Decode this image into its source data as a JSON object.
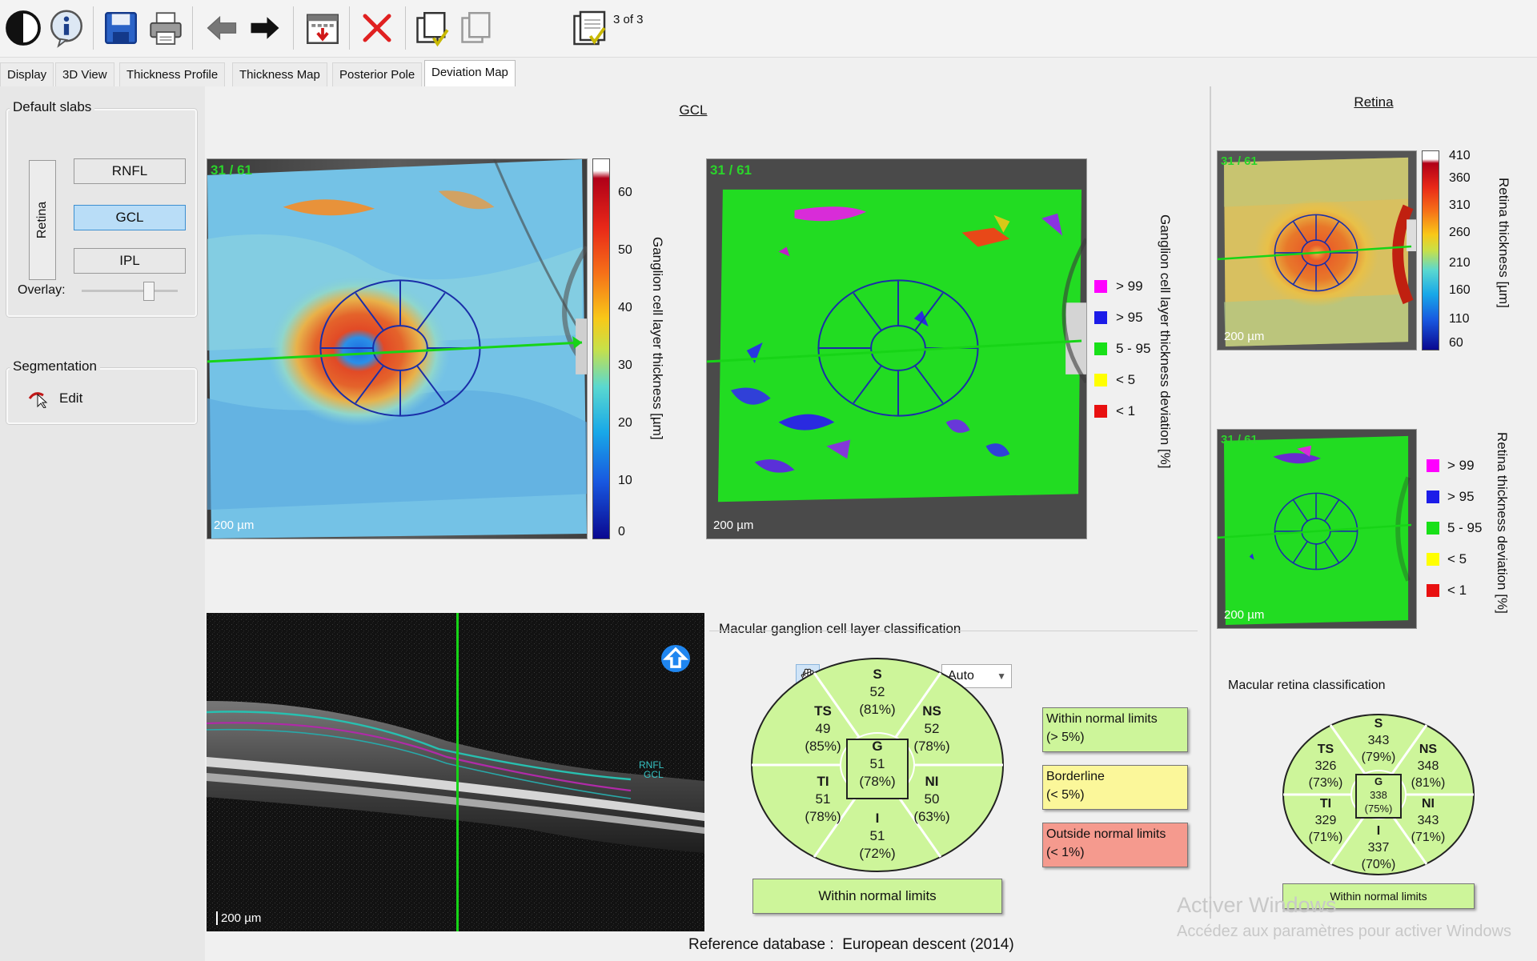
{
  "toolbar": {
    "page_count": "3 of 3",
    "buttons": [
      "contrast-icon",
      "info-icon",
      "save-icon",
      "print-icon",
      "back-arrow-icon",
      "forward-arrow-icon",
      "calendar-export-icon",
      "delete-icon",
      "copy-icon",
      "copy-disabled-icon",
      "page-report-icon"
    ]
  },
  "tabs": [
    "Display",
    "3D View",
    "Thickness Profile",
    "Thickness Map",
    "Posterior Pole",
    "Deviation Map"
  ],
  "active_tab": "Deviation Map",
  "left_panel": {
    "default_slabs_title": "Default slabs",
    "retina_tab": "Retina",
    "slabs": [
      "RNFL",
      "GCL",
      "IPL"
    ],
    "selected_slab": "GCL",
    "overlay_label": "Overlay:",
    "overlay_level": 0.7,
    "segmentation_title": "Segmentation",
    "edit_label": "Edit"
  },
  "gcl_section": {
    "title": "GCL",
    "map_index": "31 / 61",
    "scale_label": "200 µm",
    "thickness_axis_label": "Ganglion cell layer thickness [µm]",
    "thickness_ticks": [
      "60",
      "50",
      "40",
      "30",
      "20",
      "10",
      "0"
    ],
    "deviation_axis_label": "Ganglion cell layer thickness deviation [%]",
    "deviation_legend": [
      {
        "label": "> 99",
        "color": "#ff00ff"
      },
      {
        "label": "> 95",
        "color": "#1c1ce8"
      },
      {
        "label": "5 - 95",
        "color": "#18e018"
      },
      {
        "label": "< 5",
        "color": "#ffff00"
      },
      {
        "label": "< 1",
        "color": "#e81010"
      }
    ]
  },
  "retina_section": {
    "title": "Retina",
    "map_index": "31 / 61",
    "scale_label": "200 µm",
    "thickness_axis_label": "Retina thickness [µm]",
    "thickness_ticks": [
      "410",
      "360",
      "310",
      "260",
      "210",
      "160",
      "110",
      "60"
    ],
    "deviation_axis_label": "Retina thickness deviation [%]",
    "deviation_legend": [
      {
        "label": "> 99",
        "color": "#ff00ff"
      },
      {
        "label": "> 95",
        "color": "#1c1ce8"
      },
      {
        "label": "5 - 95",
        "color": "#18e018"
      },
      {
        "label": "< 5",
        "color": "#ffff00"
      },
      {
        "label": "< 1",
        "color": "#e81010"
      }
    ]
  },
  "bscan": {
    "scale_label": "200 µm",
    "layer_labels": [
      "RNFL",
      "GCL"
    ],
    "zoom_mode": "Auto"
  },
  "macular_gcl_classification": {
    "title": "Macular ganglion cell layer classification",
    "sectors": {
      "S": {
        "name": "S",
        "value": "52",
        "pct": "(81%)"
      },
      "NS": {
        "name": "NS",
        "value": "52",
        "pct": "(78%)"
      },
      "NI": {
        "name": "NI",
        "value": "50",
        "pct": "(63%)"
      },
      "I": {
        "name": "I",
        "value": "51",
        "pct": "(72%)"
      },
      "TI": {
        "name": "TI",
        "value": "51",
        "pct": "(78%)"
      },
      "TS": {
        "name": "TS",
        "value": "49",
        "pct": "(85%)"
      },
      "G": {
        "name": "G",
        "value": "51",
        "pct": "(78%)"
      }
    },
    "result": "Within normal limits",
    "legend": [
      {
        "label": "Within normal limits",
        "sub": "(> 5%)",
        "color": "#cdf59a"
      },
      {
        "label": "Borderline",
        "sub": "(< 5%)",
        "color": "#fbf79a"
      },
      {
        "label": "Outside normal limits",
        "sub": "(< 1%)",
        "color": "#f59a8e"
      }
    ]
  },
  "macular_retina_classification": {
    "title": "Macular retina classification",
    "sectors": {
      "S": {
        "name": "S",
        "value": "343",
        "pct": "(79%)"
      },
      "NS": {
        "name": "NS",
        "value": "348",
        "pct": "(81%)"
      },
      "NI": {
        "name": "NI",
        "value": "343",
        "pct": "(71%)"
      },
      "I": {
        "name": "I",
        "value": "337",
        "pct": "(70%)"
      },
      "TI": {
        "name": "TI",
        "value": "329",
        "pct": "(71%)"
      },
      "TS": {
        "name": "TS",
        "value": "326",
        "pct": "(73%)"
      },
      "G": {
        "name": "G",
        "value": "338",
        "pct": "(75%)"
      }
    },
    "result": "Within normal limits"
  },
  "footer": {
    "reference_label": "Reference database :",
    "reference_value": "European descent (2014)"
  },
  "watermark": {
    "line1": "Activer Windows",
    "line2": "Accédez aux paramètres pour activer Windows"
  },
  "colors": {
    "normal": "#cdf59a",
    "borderline": "#fbf79a",
    "outside": "#f59a8e",
    "grid_blue": "#1a2ea8",
    "scan_line": "#17d417"
  }
}
